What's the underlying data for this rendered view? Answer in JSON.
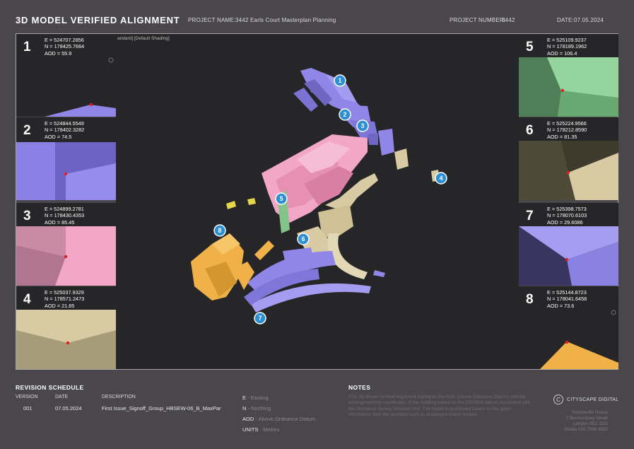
{
  "header": {
    "title": "3D MODEL VERIFIED ALIGNMENT",
    "project_name_label": "PROJECT NAME:",
    "project_name": "3442 Earls Court Masterplan Planning",
    "project_number_label": "PROJECT NUMBER:",
    "project_number": "3442",
    "date_label": "DATE:",
    "date": "07.05.2024"
  },
  "viewport": {
    "label": "andard] [Default Shading]",
    "markers": [
      "1",
      "2",
      "3",
      "4",
      "5",
      "6",
      "7",
      "8"
    ]
  },
  "panels": [
    {
      "num": "1",
      "e": "E = 524707.2856",
      "n": "N = 178425.7664",
      "aod": "AOD = 55.9"
    },
    {
      "num": "2",
      "e": "E = 524844.5549",
      "n": "N = 178402.3282",
      "aod": "AOD = 74.5"
    },
    {
      "num": "3",
      "e": "E = 524899.2781",
      "n": "N = 178430.4353",
      "aod": "AOD = 85.45"
    },
    {
      "num": "4",
      "e": "E = 525037.9329",
      "n": "N = 178571.2473",
      "aod": "AOD = 21.85"
    },
    {
      "num": "5",
      "e": "E = 525109.9237",
      "n": "N = 178189.1962",
      "aod": "AOD = 106.4"
    },
    {
      "num": "6",
      "e": "E = 525224.9566",
      "n": "N = 178212.8590",
      "aod": "AOD = 81.35"
    },
    {
      "num": "7",
      "e": "E = 525398.7573",
      "n": "N = 178070.6103",
      "aod": "AOD = 29.6086"
    },
    {
      "num": "8",
      "e": "E = 525144.8723",
      "n": "N = 178041.6458",
      "aod": "AOD = 73.6"
    }
  ],
  "revision": {
    "heading": "REVISION SCHEDULE",
    "col_version": "VERSION",
    "col_date": "DATE",
    "col_description": "DESCRIPTION",
    "rows": [
      {
        "version": "001",
        "date": "07.05.2024",
        "description": "First Issue_Signoff_Group_HBSEW-06_B_MaxPar"
      }
    ]
  },
  "legend": {
    "e_key": "E",
    "e_desc": " - Easting",
    "n_key": "N",
    "n_desc": " - Northing",
    "aod_key": "AOD",
    "aod_desc": " - Above Ordnance Datum",
    "units_key": "UNITS",
    "units_desc": " - Metres"
  },
  "notes": {
    "heading": "NOTES",
    "text": "This 3D Model Verified Alignment highlights the AOD (Above Ordnance Datum) and the easting/northing coordinates of the building based on the OSGB36 datum associated with the Ordnance Survey National Grid. The model is positioned based on the given information from the architect such as drawings/context models."
  },
  "company": {
    "logo_letter": "C",
    "name": "CITYSCAPE DIGITAL",
    "address_lines": [
      "Pentonville House",
      "7 Bermondsey Street",
      "London SE1 2DD",
      "Studio 020 7566 8550"
    ]
  },
  "colors": {
    "background": "#4a474c",
    "viewport": "#262527",
    "marker": "#2b8fd6",
    "purple": "#8f86e8",
    "pink": "#f2a7c6",
    "beige": "#d8cba3",
    "orange": "#f0b248",
    "green": "#82c48a",
    "yellow": "#e6d64a"
  }
}
